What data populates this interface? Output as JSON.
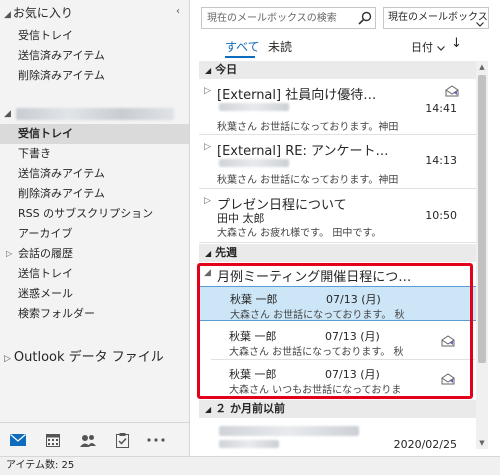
{
  "folders": {
    "favorites_header": "お気に入り",
    "favorites": [
      "受信トレイ",
      "送信済みアイテム",
      "削除済みアイテム"
    ],
    "account_folders": [
      {
        "label": "受信トレイ",
        "selected": true,
        "expandable": false
      },
      {
        "label": "下書き",
        "selected": false,
        "expandable": false
      },
      {
        "label": "送信済みアイテム",
        "selected": false,
        "expandable": false
      },
      {
        "label": "削除済みアイテム",
        "selected": false,
        "expandable": false
      },
      {
        "label": "RSS のサブスクリプション",
        "selected": false,
        "expandable": false
      },
      {
        "label": "アーカイブ",
        "selected": false,
        "expandable": false
      },
      {
        "label": "会話の履歴",
        "selected": false,
        "expandable": true
      },
      {
        "label": "送信トレイ",
        "selected": false,
        "expandable": false
      },
      {
        "label": "迷惑メール",
        "selected": false,
        "expandable": false
      },
      {
        "label": "検索フォルダー",
        "selected": false,
        "expandable": false
      }
    ],
    "pst_header": "Outlook データ ファイル"
  },
  "nav_icons": [
    "mail-icon",
    "calendar-icon",
    "people-icon",
    "tasks-icon",
    "more-icon"
  ],
  "search": {
    "placeholder": "現在のメールボックスの検索",
    "scope": "現在のメールボックス"
  },
  "tabs": {
    "all": "すべて",
    "unread": "未読"
  },
  "sort": {
    "by": "日付",
    "arrow": "↓"
  },
  "sections": {
    "today": "今日",
    "last_week": "先週",
    "two_months": "２ か月前以前"
  },
  "messages": [
    {
      "subject": "[External] 社員向け優待…",
      "preview": "秋葉さん お世話になっております。神田",
      "time": "14:41",
      "icon": "envelope-reply-icon"
    },
    {
      "subject": "[External] RE: アンケート…",
      "preview": "秋葉さん お世話になっております。神田",
      "time": "14:13"
    },
    {
      "subject": "プレゼン日程について",
      "sender": "田中 太郎",
      "preview": "大森さん お疲れ様です。 田中です。",
      "time": "10:50"
    }
  ],
  "thread": {
    "subject": "月例ミーティング開催日程につ…",
    "items": [
      {
        "sender": "秋葉 一郎",
        "date": "07/13 (月)",
        "preview": "大森さん お世話になっております。 秋",
        "selected": true
      },
      {
        "sender": "秋葉 一郎",
        "date": "07/13 (月)",
        "preview": "大森さん お世話になっております。 秋",
        "selected": false,
        "icon": "envelope-reply-icon"
      },
      {
        "sender": "秋葉 一郎",
        "date": "07/13 (月)",
        "preview": "大森さん いつもお世話になっておりま",
        "selected": false,
        "icon": "envelope-reply-icon"
      }
    ]
  },
  "old_message": {
    "time": "2020/02/25"
  },
  "status_bar": {
    "label": "アイテム数: 25"
  },
  "colors": {
    "accent": "#0f6cbd",
    "highlight": "#e3001b",
    "selected_row": "#cde6f7"
  }
}
